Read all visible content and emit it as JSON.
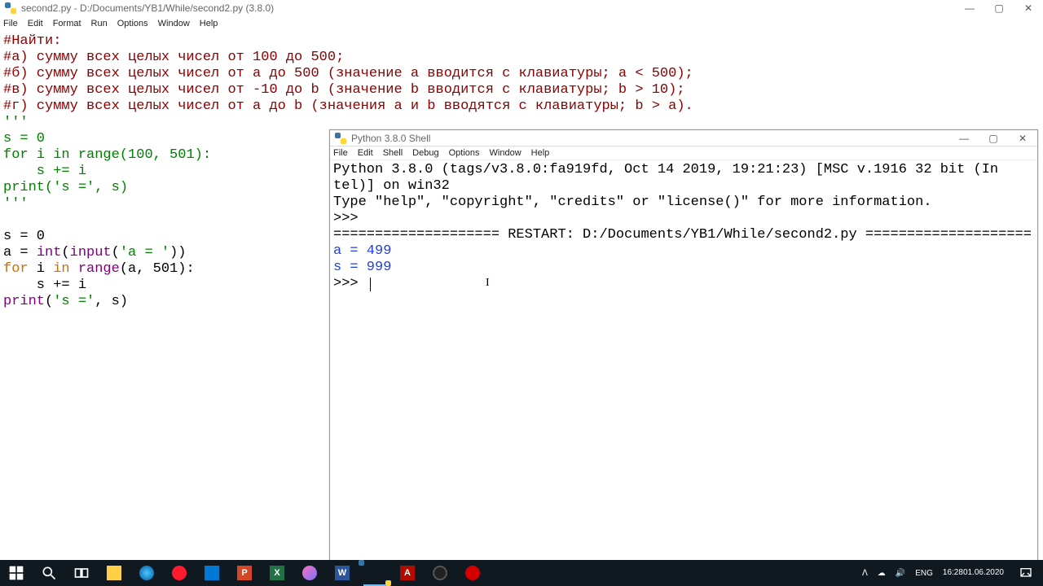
{
  "editor": {
    "title": "second2.py - D:/Documents/YB1/While/second2.py (3.8.0)",
    "menu": [
      "File",
      "Edit",
      "Format",
      "Run",
      "Options",
      "Window",
      "Help"
    ],
    "code": {
      "l1": "#Найти:",
      "l2": "#а) сумму всех целых чисел от 100 до 500;",
      "l3": "#б) сумму всех целых чисел от a до 500 (значение a вводится с клавиатуры; a < 500);",
      "l4": "#в) сумму всех целых чисел от -10 до b (значение b вводится с клавиатуры; b > 10);",
      "l5": "#г) сумму всех целых чисел от a до b (значения a и b вводятся с клавиатуры; b > a).",
      "l6": "'''",
      "l7a": "s = 0",
      "l8_for": "for",
      "l8_rest1": " i ",
      "l8_in": "in",
      "l8_rest2": " ",
      "l8_range": "range",
      "l8_rest3": "(100, 501):",
      "l9": "    s += i",
      "l10_print": "print",
      "l10_rest1": "(",
      "l10_str": "'s ='",
      "l10_rest2": ", s)",
      "l11": "'''",
      "blank": "",
      "l12": "s = 0",
      "l13a": "a = ",
      "l13_int": "int",
      "l13_rest1": "(",
      "l13_input": "input",
      "l13_rest2": "(",
      "l13_str": "'a = '",
      "l13_rest3": "))",
      "l14_for": "for",
      "l14_rest1": " i ",
      "l14_in": "in",
      "l14_rest2": " ",
      "l14_range": "range",
      "l14_rest3": "(a, 501):",
      "l15": "    s += i",
      "l16_print": "print",
      "l16_rest1": "(",
      "l16_str": "'s ='",
      "l16_rest2": ", s)"
    }
  },
  "shell": {
    "title": "Python 3.8.0 Shell",
    "menu": [
      "File",
      "Edit",
      "Shell",
      "Debug",
      "Options",
      "Window",
      "Help"
    ],
    "output": {
      "banner1": "Python 3.8.0 (tags/v3.8.0:fa919fd, Oct 14 2019, 19:21:23) [MSC v.1916 32 bit (In",
      "banner2": "tel)] on win32",
      "banner3": "Type \"help\", \"copyright\", \"credits\" or \"license()\" for more information.",
      "prompt": ">>> ",
      "restart": "==================== RESTART: D:/Documents/YB1/While/second2.py ====================",
      "r1": "a = 499",
      "r2": "s = 999"
    }
  },
  "winbtn": {
    "min": "—",
    "max": "▢",
    "close": "✕"
  },
  "tray": {
    "chevron": "ᐱ",
    "cloud": "☁",
    "vol": "🔊",
    "lang": "ENG",
    "time": "16:28",
    "date": "01.06.2020"
  }
}
